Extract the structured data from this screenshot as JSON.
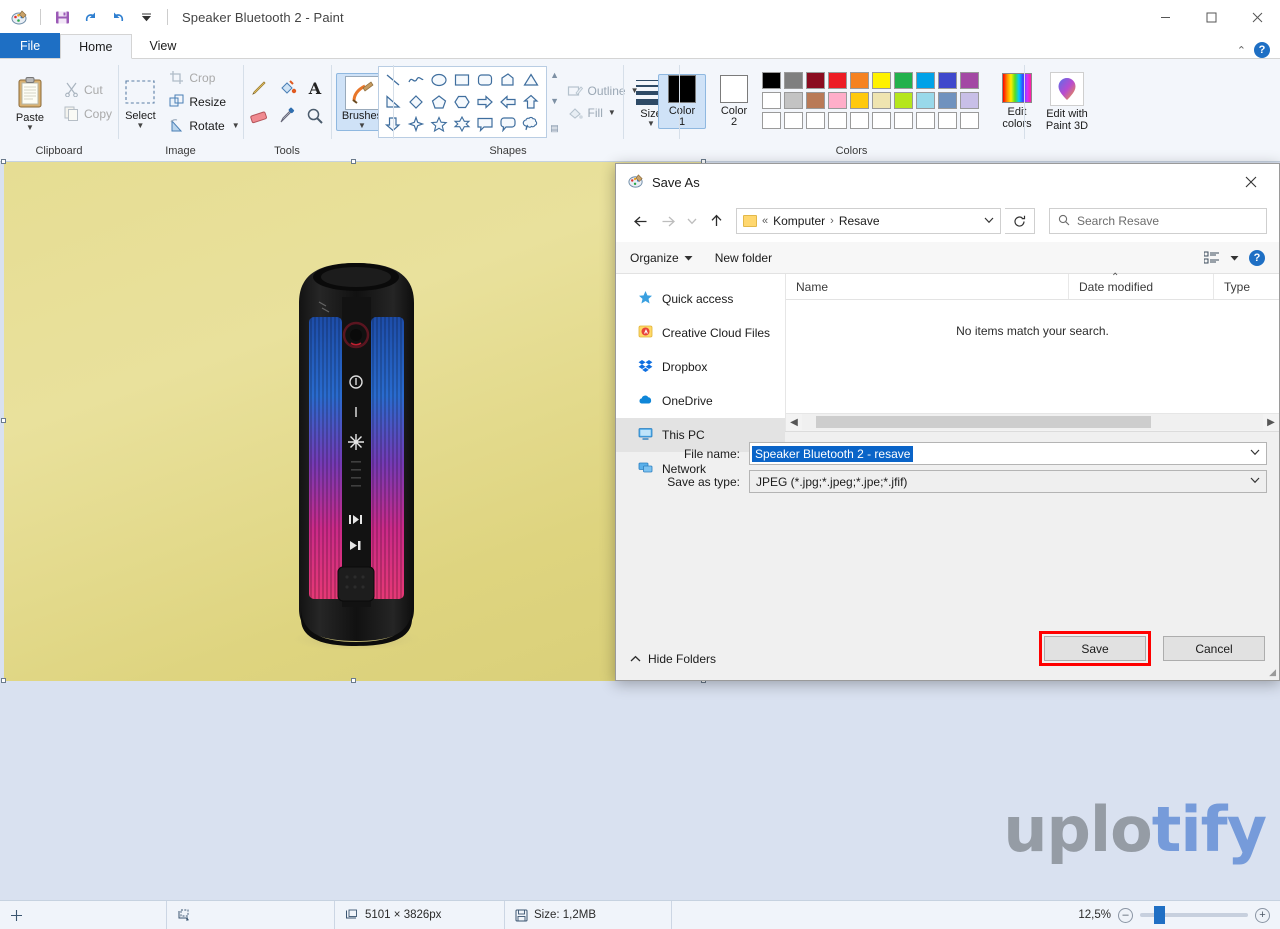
{
  "window": {
    "title": "Speaker Bluetooth 2 - Paint",
    "app_icon": "paint-icon",
    "quick_access": [
      "save-icon",
      "undo-icon",
      "redo-icon",
      "customize-caret-icon"
    ],
    "minimize": "–",
    "maximize": "□",
    "close": "✕"
  },
  "tabs": {
    "file": "File",
    "items": [
      {
        "label": "Home",
        "active": true
      },
      {
        "label": "View",
        "active": false
      }
    ],
    "collapse_icon": "chevron-up-icon",
    "help_icon": "?"
  },
  "ribbon": {
    "clipboard": {
      "label": "Clipboard",
      "paste": "Paste",
      "cut": "Cut",
      "copy": "Copy"
    },
    "image": {
      "label": "Image",
      "select": "Select",
      "crop": "Crop",
      "resize": "Resize",
      "rotate": "Rotate"
    },
    "tools": {
      "label": "Tools",
      "items": [
        "pencil-icon",
        "fill-icon",
        "text-icon",
        "eraser-icon",
        "color-picker-icon",
        "magnifier-icon"
      ]
    },
    "brushes": {
      "label": "Brushes"
    },
    "shapes": {
      "label": "Shapes",
      "outline": "Outline",
      "fill": "Fill"
    },
    "size": {
      "label": "Size"
    },
    "colors": {
      "label": "Colors",
      "color1": "Color",
      "color1_num": "1",
      "color2": "Color",
      "color2_num": "2",
      "color1_value": "#000000",
      "color2_value": "#ffffff",
      "edit_colors": "Edit\ncolors",
      "edit_colors_line1": "Edit",
      "edit_colors_line2": "colors",
      "row1": [
        "#000000",
        "#7f7f7f",
        "#8b0c20",
        "#ed1c24",
        "#f58220",
        "#fff200",
        "#22b14c",
        "#00a2e8",
        "#3f48cc",
        "#a349a4"
      ],
      "row2": [
        "#ffffff",
        "#c3c3c3",
        "#b97a57",
        "#ffaec9",
        "#ffc90e",
        "#efe4b0",
        "#b5e61d",
        "#99d9ea",
        "#7092be",
        "#c8bfe7"
      ],
      "row3": [
        "#ffffff",
        "#ffffff",
        "#ffffff",
        "#ffffff",
        "#ffffff",
        "#ffffff",
        "#ffffff",
        "#ffffff",
        "#ffffff",
        "#ffffff"
      ]
    },
    "paint3d": {
      "line1": "Edit with",
      "line2": "Paint 3D"
    }
  },
  "statusbar": {
    "cursor_icon": "crosshair-icon",
    "selection_icon": "selection-size-icon",
    "image_size_icon": "image-size-icon",
    "image_size": "5101 × 3826px",
    "file_size_icon": "disk-icon",
    "file_size": "Size: 1,2MB",
    "zoom_level": "12,5%",
    "zoom_out": "–",
    "zoom_in": "+"
  },
  "watermark": {
    "part1": "uplo",
    "part2": "tify"
  },
  "dialog": {
    "title": "Save As",
    "icon": "paint-icon",
    "close": "✕",
    "nav": {
      "back": "←",
      "forward": "→",
      "recent": "⌄",
      "up": "↑",
      "breadcrumb_prefix": "«",
      "breadcrumb": [
        "Komputer",
        "Resave"
      ],
      "breadcrumb_sep": "›",
      "dropdown_caret": "⌄",
      "refresh": "↻",
      "search_placeholder": "Search Resave",
      "search_icon": "search-icon"
    },
    "commands": {
      "organize": "Organize",
      "new_folder": "New folder",
      "view_icon": "view-layout-icon",
      "help_icon": "?"
    },
    "nav_pane": [
      {
        "label": "Quick access",
        "icon": "star-icon",
        "selected": false
      },
      {
        "label": "Creative Cloud Files",
        "icon": "creative-cloud-icon",
        "selected": false
      },
      {
        "label": "Dropbox",
        "icon": "dropbox-icon",
        "selected": false
      },
      {
        "label": "OneDrive",
        "icon": "onedrive-icon",
        "selected": false
      },
      {
        "label": "This PC",
        "icon": "this-pc-icon",
        "selected": true
      },
      {
        "label": "Network",
        "icon": "network-icon",
        "selected": false
      }
    ],
    "columns": [
      "Name",
      "Date modified",
      "Type"
    ],
    "empty_message": "No items match your search.",
    "file_name_label": "File name:",
    "file_name_value": "Speaker Bluetooth 2 - resave",
    "save_type_label": "Save as type:",
    "save_type_value": "JPEG (*.jpg;*.jpeg;*.jpe;*.jfif)",
    "hide_folders": "Hide Folders",
    "save": "Save",
    "cancel": "Cancel",
    "save_highlight_color": "#ff0000"
  }
}
